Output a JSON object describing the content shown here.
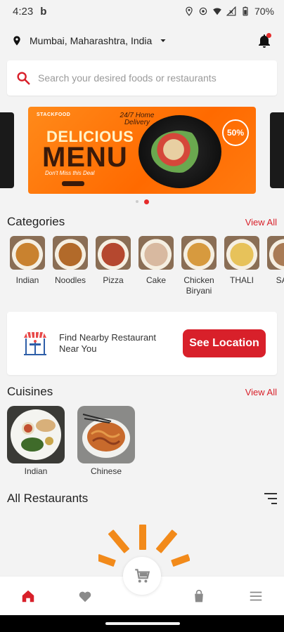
{
  "status_bar": {
    "time": "4:23",
    "app_glyph": "b",
    "battery": "70%"
  },
  "location": {
    "text": "Mumbai, Maharashtra, India"
  },
  "search": {
    "placeholder": "Search your desired foods or restaurants"
  },
  "banner": {
    "brand": "STACKFOOD",
    "line1": "DELICIOUS",
    "line2": "MENU",
    "line3": "Don't Miss this Deal",
    "badge": "24/7 Home Delivery",
    "offer": "50%"
  },
  "categories_section": {
    "title": "Categories",
    "view_all": "View All",
    "items": [
      {
        "label": "Indian",
        "color": "#c9822f"
      },
      {
        "label": "Noodles",
        "color": "#b26a2a"
      },
      {
        "label": "Pizza",
        "color": "#b5482f"
      },
      {
        "label": "Cake",
        "color": "#d8b9a0"
      },
      {
        "label": "Chicken Biryani",
        "color": "#d79a3e"
      },
      {
        "label": "THALI",
        "color": "#e7c25a"
      },
      {
        "label": "SAN",
        "color": "#a97b55"
      }
    ]
  },
  "find_card": {
    "text": "Find Nearby Restaurant Near You",
    "button": "See Location"
  },
  "cuisines_section": {
    "title": "Cuisines",
    "view_all": "View All",
    "items": [
      {
        "label": "Indian"
      },
      {
        "label": "Chinese"
      }
    ]
  },
  "restaurants_section": {
    "title": "All Restaurants"
  },
  "colors": {
    "accent": "#d8202a",
    "loader": "#f28a1a"
  },
  "nav": {
    "icons": [
      "home-icon",
      "heart-icon",
      "cart-icon",
      "bag-icon",
      "menu-icon"
    ]
  }
}
